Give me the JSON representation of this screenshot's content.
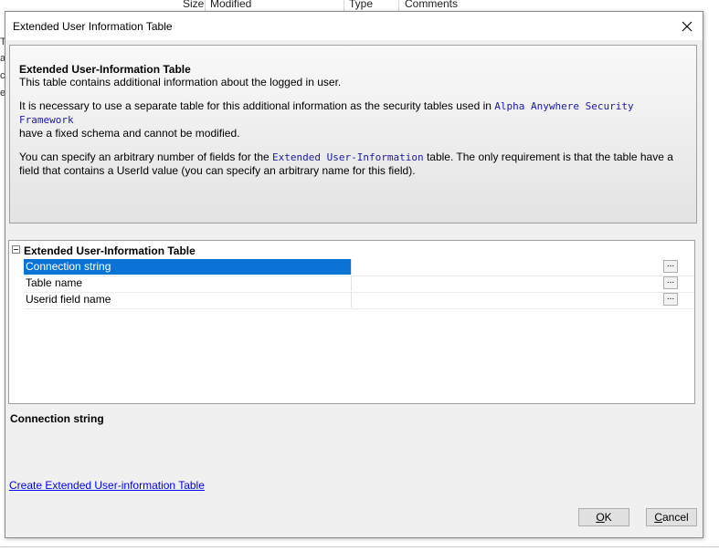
{
  "background": {
    "columns": [
      "Size",
      "Modified",
      "Type",
      "Comments"
    ],
    "left_letters": [
      "T",
      "a",
      "c",
      "e"
    ]
  },
  "dialog": {
    "title": "Extended User Information Table",
    "close_glyph": "✕",
    "info": {
      "heading": "Extended User-Information Table",
      "line1": "This table contains additional information about the logged in user.",
      "p2_before": "It is necessary to use a separate table for this additional information as the security tables used in ",
      "p2_code": "Alpha Anywhere Security Framework",
      "p2_after": "have a fixed schema and cannot be modified.",
      "p3_before": "You can specify an arbitrary number of fields for the ",
      "p3_code": "Extended User-Information",
      "p3_after": " table. The only requirement is that the table have a field that contains a UserId value (you can specify an arbitrary name for this field)."
    },
    "grid": {
      "group_label": "Extended User-Information Table",
      "rows": [
        {
          "name": "Connection string",
          "value": ""
        },
        {
          "name": "Table name",
          "value": ""
        },
        {
          "name": "Userid field name",
          "value": ""
        }
      ],
      "ellipsis": "...",
      "selected_row": 0
    },
    "description_title": "Connection string",
    "create_link": "Create Extended User-information Table",
    "ok_accel": "O",
    "ok_rest": "K",
    "cancel_accel": "C",
    "cancel_rest": "ancel"
  }
}
